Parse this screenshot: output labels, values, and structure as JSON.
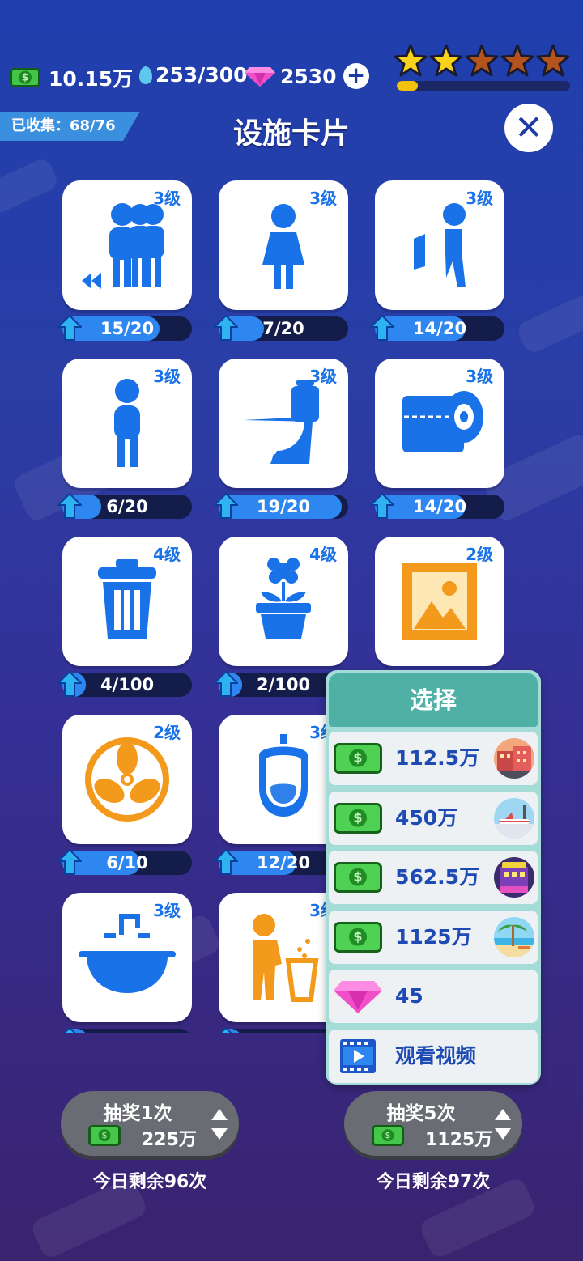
{
  "resources": {
    "cash": "10.15万",
    "water": "253/300",
    "gems": "2530"
  },
  "stars": {
    "filled": 2,
    "total": 5,
    "progress_fraction": 0.12
  },
  "header": {
    "collected": "已收集：68/76",
    "title": "设施卡片"
  },
  "cards": [
    {
      "level": "3级",
      "progress": "15/20",
      "fill": 0.75,
      "icon": "queue-people-icon"
    },
    {
      "level": "3级",
      "progress": "7/20",
      "fill": 0.35,
      "icon": "woman-icon"
    },
    {
      "level": "3级",
      "progress": "14/20",
      "fill": 0.7,
      "icon": "urinal-man-icon"
    },
    {
      "level": "3级",
      "progress": "6/20",
      "fill": 0.3,
      "icon": "man-icon"
    },
    {
      "level": "3级",
      "progress": "19/20",
      "fill": 0.95,
      "icon": "toilet-icon"
    },
    {
      "level": "3级",
      "progress": "14/20",
      "fill": 0.7,
      "icon": "toilet-paper-icon"
    },
    {
      "level": "4级",
      "progress": "4/100",
      "fill": 0.04,
      "icon": "trash-can-icon"
    },
    {
      "level": "4级",
      "progress": "2/100",
      "fill": 0.02,
      "icon": "flower-pot-icon"
    },
    {
      "level": "2级",
      "progress": "",
      "fill": 0,
      "icon": "picture-frame-icon"
    },
    {
      "level": "2级",
      "progress": "6/10",
      "fill": 0.6,
      "icon": "fan-icon"
    },
    {
      "level": "3级",
      "progress": "12/20",
      "fill": 0.6,
      "icon": "urinal-icon"
    },
    {
      "level": "",
      "progress": "",
      "fill": 0,
      "icon": "empty"
    },
    {
      "level": "3级",
      "progress": "",
      "fill": 0.2,
      "icon": "sink-icon"
    },
    {
      "level": "3级",
      "progress": "",
      "fill": 0.1,
      "icon": "litter-person-icon"
    }
  ],
  "popup": {
    "title": "选择",
    "options": [
      {
        "value": "112.5万",
        "type": "cash",
        "thumb": "city-building-thumb"
      },
      {
        "value": "450万",
        "type": "cash",
        "thumb": "airport-thumb"
      },
      {
        "value": "562.5万",
        "type": "cash",
        "thumb": "bar-night-thumb"
      },
      {
        "value": "1125万",
        "type": "cash",
        "thumb": "beach-thumb"
      },
      {
        "value": "45",
        "type": "gem",
        "thumb": ""
      },
      {
        "value": "观看视频",
        "type": "video",
        "thumb": ""
      }
    ]
  },
  "draw_buttons": [
    {
      "label": "抽奖1次",
      "cost": "225万",
      "remain": "今日剩余96次"
    },
    {
      "label": "抽奖5次",
      "cost": "1125万",
      "remain": "今日剩余97次"
    }
  ],
  "colors": {
    "accent_blue": "#1a72e8",
    "popup_teal": "#4fb0a5",
    "star_gold": "#f2c20f"
  }
}
